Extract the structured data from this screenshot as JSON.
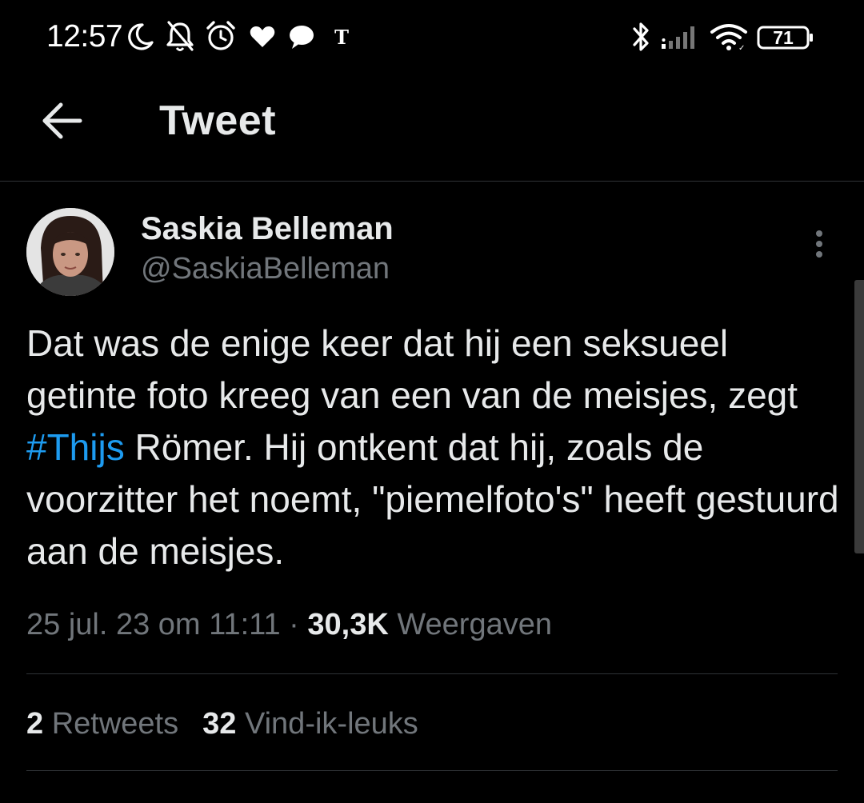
{
  "status_bar": {
    "time": "12:57",
    "battery": "71",
    "icons": [
      "moon-icon",
      "bell-off-icon",
      "alarm-icon",
      "heart-icon",
      "chat-bubble-icon",
      "telegraaf-icon",
      "bluetooth-icon",
      "signal-icon",
      "wifi-icon",
      "battery-icon"
    ]
  },
  "header": {
    "title": "Tweet",
    "back_icon": "arrow-left-icon"
  },
  "tweet": {
    "author": {
      "name": "Saskia Belleman",
      "handle": "@SaskiaBelleman"
    },
    "text": {
      "part1": "Dat was de enige keer dat hij een seksueel getinte foto kreeg van een van de meisjes, zegt ",
      "hashtag": "#Thijs",
      "part2": " Römer. Hij ontkent dat hij, zoals de voorzitter het noemt, \"piemelfoto's\" heeft gestuurd aan de meisjes."
    },
    "timestamp": "25 jul. 23 om 11:11",
    "separator": " · ",
    "views_count": "30,3K",
    "views_label": " Weergaven",
    "retweets_count": "2",
    "retweets_label": " Retweets",
    "likes_count": "32",
    "likes_label": " Vind-ik-leuks"
  },
  "colors": {
    "background": "#000000",
    "text": "#e7e9ea",
    "secondary": "#71767b",
    "accent": "#1d9bf0",
    "divider": "#2f3336"
  }
}
